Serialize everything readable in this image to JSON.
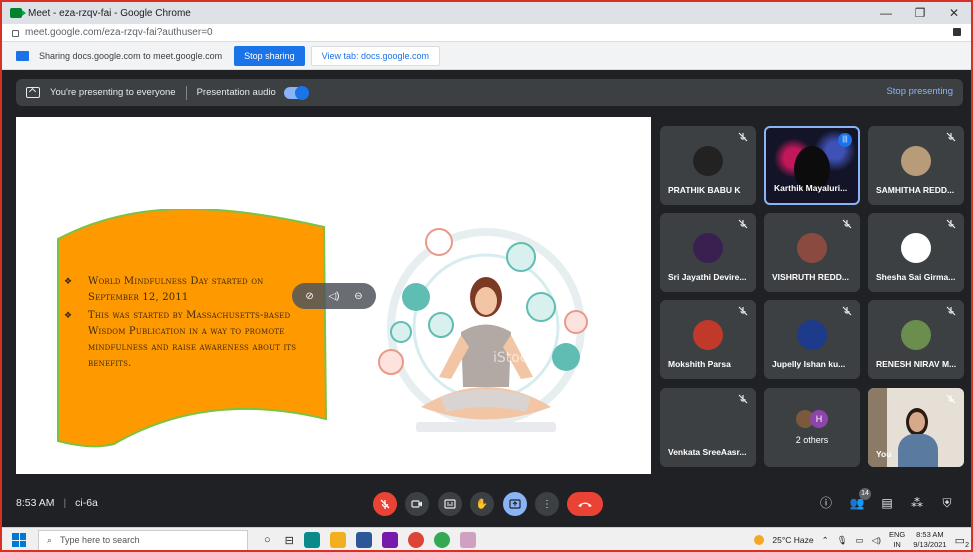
{
  "browser": {
    "window_title": "Meet - eza-rzqv-fai - Google Chrome",
    "url": "meet.google.com/eza-rzqv-fai?authuser=0",
    "window_controls": [
      "—",
      "❐",
      "✕"
    ]
  },
  "share_bar": {
    "text": "Sharing docs.google.com to meet.google.com",
    "stop_sharing": "Stop sharing",
    "view_tab": "View tab: docs.google.com"
  },
  "present_bar": {
    "status": "You're presenting to everyone",
    "audio_label": "Presentation audio",
    "audio_on": true,
    "stop_presenting": "Stop presenting"
  },
  "slide": {
    "bullets": [
      "World Mindfulness Day started on September 12, 2011",
      "This was started by Massachusetts-based Wisdom Publication in a way to promote mindfulness and raise awareness about its benefits."
    ],
    "watermark": "iStock"
  },
  "participants": [
    {
      "name": "PRATHIK BABU K",
      "muted": true,
      "avatar_color": "#222222"
    },
    {
      "name": "Karthik Mayaluri...",
      "muted": false,
      "speaking": true,
      "avatar_color": "#1b1b2e"
    },
    {
      "name": "SAMHITHA REDD...",
      "muted": true,
      "avatar_color": "#b89c7a"
    },
    {
      "name": "Sri Jayathi Devire...",
      "muted": true,
      "avatar_color": "#3a2050"
    },
    {
      "name": "VISHRUTH REDD...",
      "muted": true,
      "avatar_color": "#8a4a40"
    },
    {
      "name": "Shesha Sai Girma...",
      "muted": true,
      "avatar_color": "#ffffff"
    },
    {
      "name": "Mokshith Parsa",
      "muted": true,
      "avatar_color": "#c0392b"
    },
    {
      "name": "Jupelly Ishan ku...",
      "muted": true,
      "avatar_color": "#1e3a8a"
    },
    {
      "name": "RENESH NIRAV M...",
      "muted": true,
      "avatar_color": "#6b8e4e"
    },
    {
      "name": "Venkata SreeAasr...",
      "muted": true,
      "avatar_color": "#3c4043"
    }
  ],
  "others_tile": {
    "label": "2 others",
    "initial": "H"
  },
  "self_tile": {
    "label": "You"
  },
  "bottom_bar": {
    "time": "8:53 AM",
    "meeting_code": "ci-6a",
    "people_count": "14"
  },
  "taskbar": {
    "search_placeholder": "Type here to search",
    "weather": "25°C  Haze",
    "lang_top": "ENG",
    "lang_bottom": "IN",
    "clock_time": "8:53 AM",
    "clock_date": "9/13/2021",
    "notif_count": "2"
  }
}
